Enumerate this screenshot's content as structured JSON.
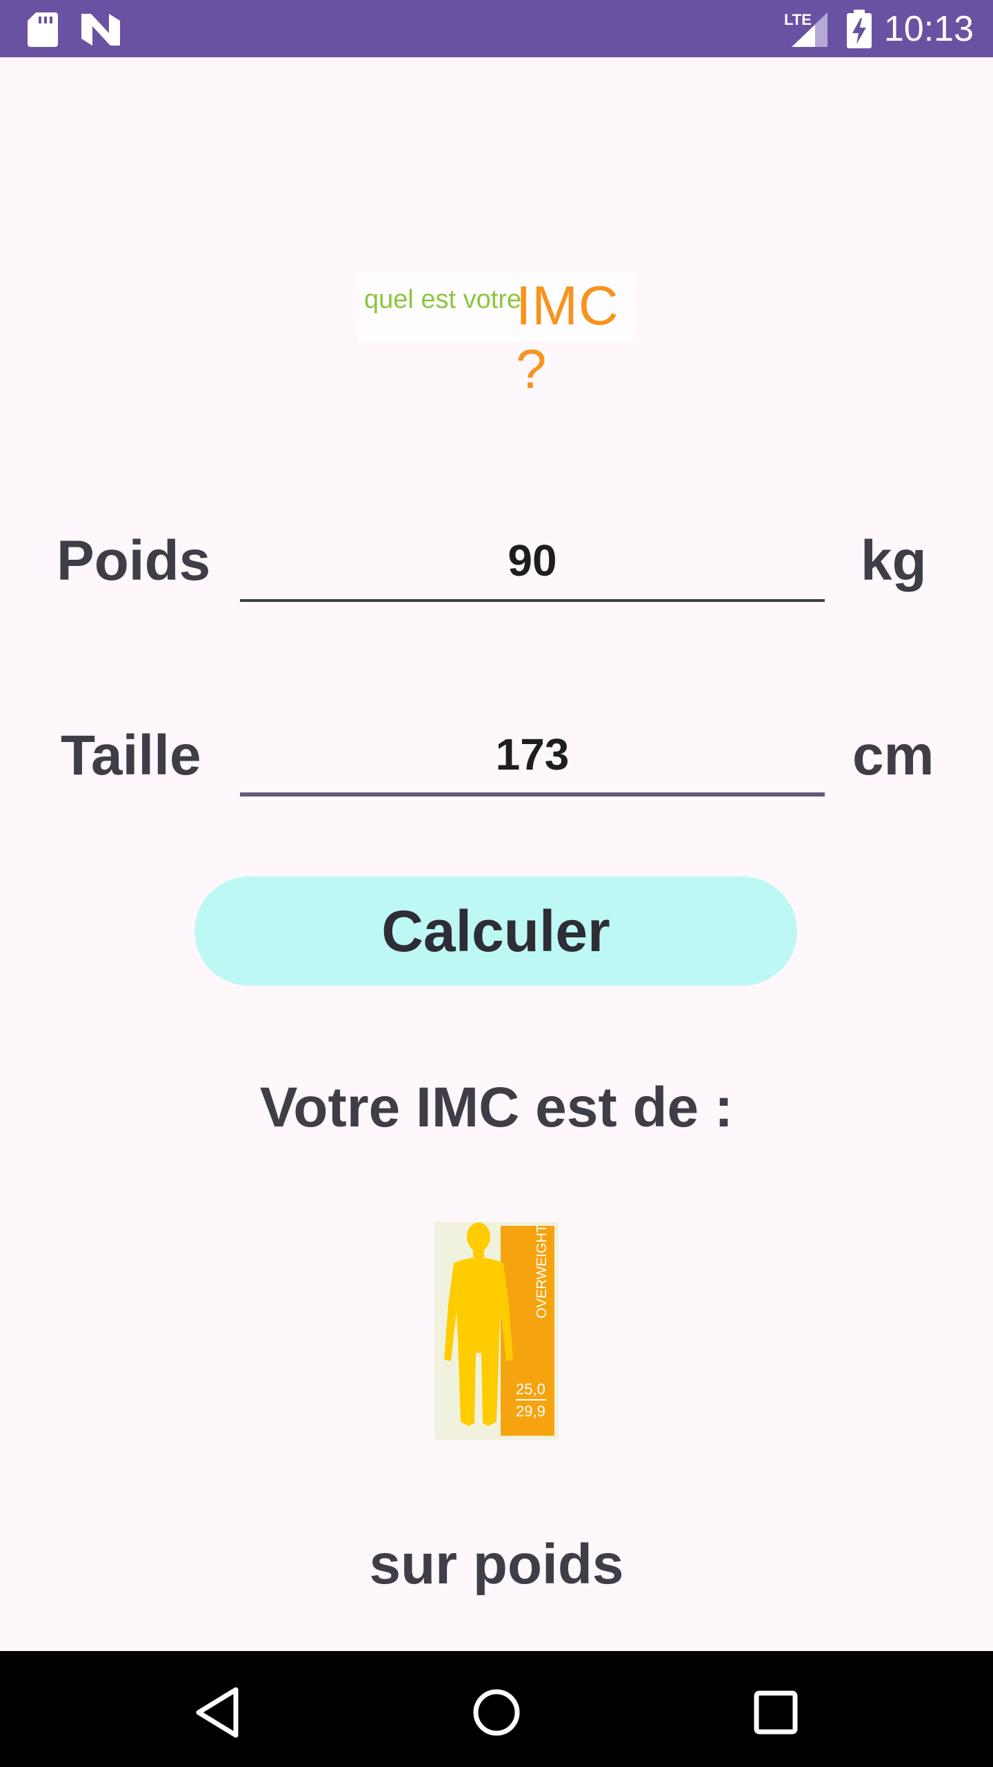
{
  "status_bar": {
    "time": "10:13",
    "network": "LTE",
    "icons": [
      "sd-card-icon",
      "n-logo-icon",
      "signal-icon",
      "battery-charging-icon"
    ]
  },
  "logo": {
    "small_text": "quel est votre",
    "big_text": "IMC ?"
  },
  "form": {
    "weight": {
      "label": "Poids",
      "value": "90",
      "unit": "kg"
    },
    "height": {
      "label": "Taille",
      "value": "173",
      "unit": "cm"
    },
    "calculate_label": "Calculer"
  },
  "result": {
    "title": "Votre IMC est de :",
    "image": {
      "category_label": "OVERWEIGHT",
      "range_low": "25,0",
      "range_high": "29,9",
      "colors": {
        "background": "#f1f2de",
        "panel": "#f5a30f",
        "figure": "#ffcc00"
      }
    },
    "text": "sur poids"
  },
  "nav": {
    "icons": [
      "back-icon",
      "home-icon",
      "recents-icon"
    ]
  },
  "colors": {
    "status_bar": "#6a52a3",
    "button": "#bef8f5",
    "text": "#3f3d47",
    "logo_green": "#8cc63f",
    "logo_orange": "#f7931e"
  }
}
